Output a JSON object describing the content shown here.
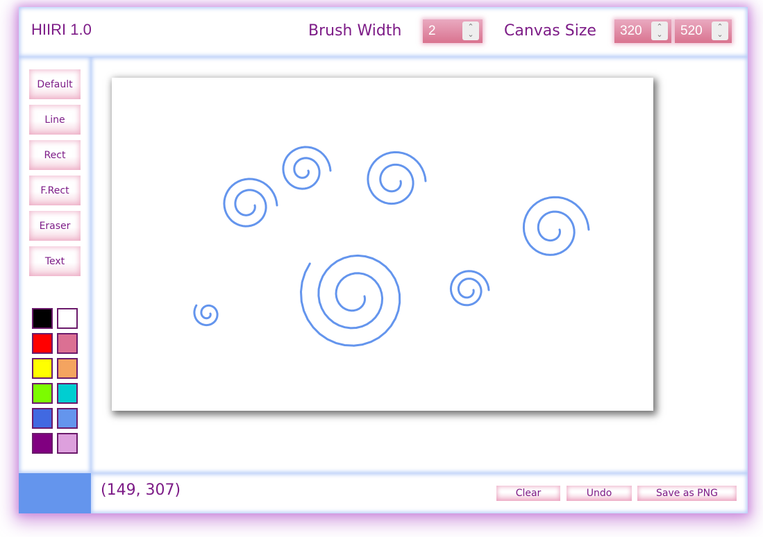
{
  "header": {
    "title": "HIIRI 1.0",
    "brush_width_label": "Brush Width",
    "brush_width_value": "2",
    "canvas_size_label": "Canvas Size",
    "canvas_height_value": "320",
    "canvas_width_value": "520"
  },
  "tools": [
    {
      "label": "Default"
    },
    {
      "label": "Line"
    },
    {
      "label": "Rect"
    },
    {
      "label": "F.Rect"
    },
    {
      "label": "Eraser"
    },
    {
      "label": "Text"
    }
  ],
  "palette": [
    "#000000",
    "#ffffff",
    "#ff0000",
    "#db7093",
    "#ffff00",
    "#f4a460",
    "#7cfc00",
    "#00ced1",
    "#4169e1",
    "#6495ed",
    "#800080",
    "#dda0dd"
  ],
  "current_color": "#6495ed",
  "stroke_color": "#6495ed",
  "footer": {
    "coords": "(149, 307)",
    "clear_label": "Clear",
    "undo_label": "Undo",
    "save_label": "Save as PNG"
  }
}
